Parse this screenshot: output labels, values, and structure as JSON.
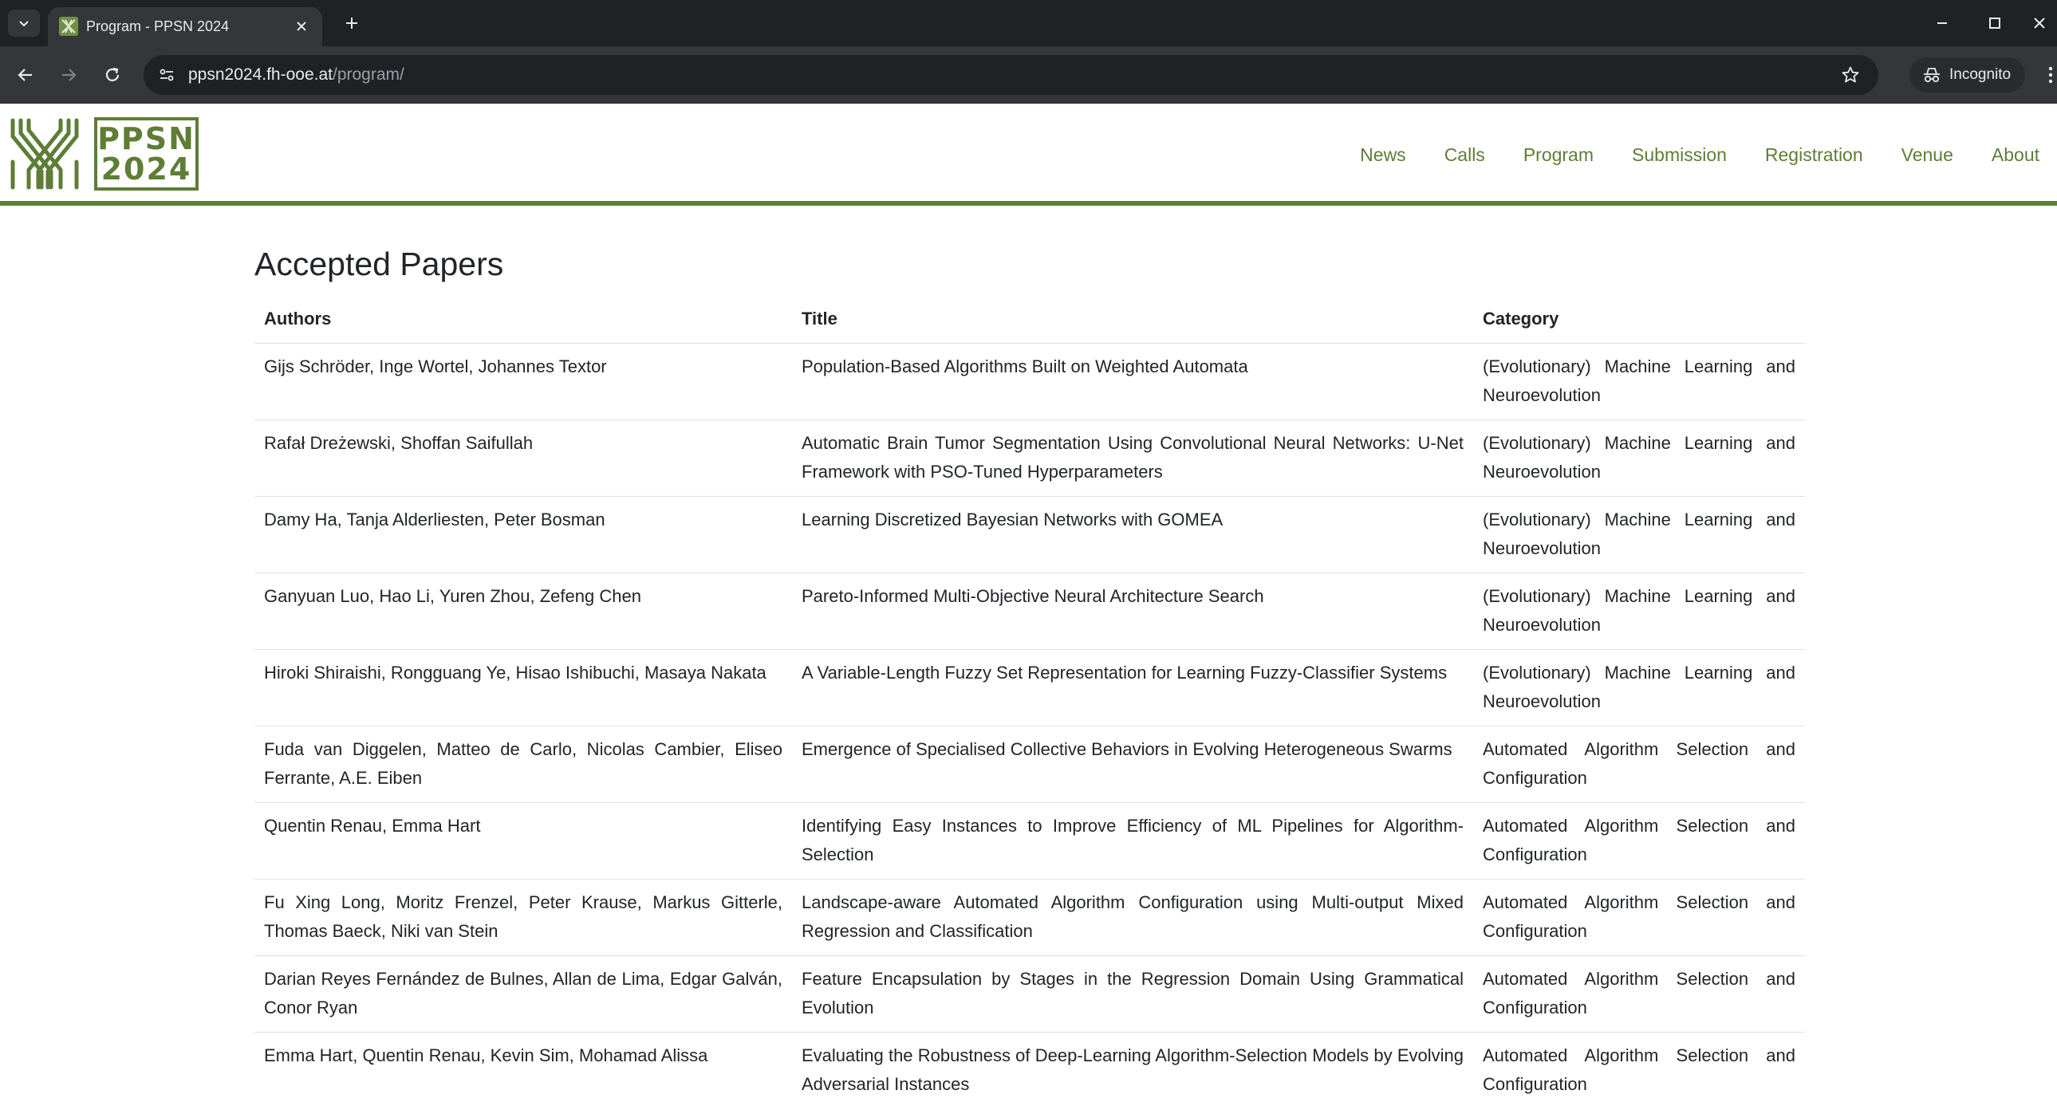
{
  "browser": {
    "tab_title": "Program - PPSN 2024",
    "url_host": "ppsn2024.fh-ooe.at",
    "url_path": "/program/",
    "incognito_label": "Incognito"
  },
  "site": {
    "logo_line1": "PPSN",
    "logo_line2": "2024",
    "nav": [
      "News",
      "Calls",
      "Program",
      "Submission",
      "Registration",
      "Venue",
      "About"
    ],
    "brand_color": "#5e7d35"
  },
  "page": {
    "title": "Accepted Papers",
    "columns": [
      "Authors",
      "Title",
      "Category"
    ],
    "rows": [
      {
        "authors": "Gijs Schröder, Inge Wortel, Johannes Textor",
        "title": "Population-Based Algorithms Built on Weighted Automata",
        "category": "(Evolutionary) Machine Learning and Neuroevolution"
      },
      {
        "authors": "Rafał Dreżewski, Shoffan Saifullah",
        "title": "Automatic Brain Tumor Segmentation Using Convolutional Neural Networks: U-Net Framework with PSO-Tuned Hyperparameters",
        "category": "(Evolutionary) Machine Learning and Neuroevolution"
      },
      {
        "authors": "Damy Ha, Tanja Alderliesten, Peter Bosman",
        "title": "Learning Discretized Bayesian Networks with GOMEA",
        "category": "(Evolutionary) Machine Learning and Neuroevolution"
      },
      {
        "authors": "Ganyuan Luo, Hao Li, Yuren Zhou, Zefeng Chen",
        "title": "Pareto-Informed Multi-Objective Neural Architecture Search",
        "category": "(Evolutionary) Machine Learning and Neuroevolution"
      },
      {
        "authors": "Hiroki Shiraishi, Rongguang Ye, Hisao Ishibuchi, Masaya Nakata",
        "title": "A Variable-Length Fuzzy Set Representation for Learning Fuzzy-Classifier Systems",
        "category": "(Evolutionary) Machine Learning and Neuroevolution"
      },
      {
        "authors": "Fuda van Diggelen, Matteo de Carlo, Nicolas Cambier, Eliseo Ferrante, A.E. Eiben",
        "title": "Emergence of Specialised Collective Behaviors in Evolving Heterogeneous Swarms",
        "category": "Automated Algorithm Selection and Configuration"
      },
      {
        "authors": "Quentin Renau, Emma Hart",
        "title": "Identifying Easy Instances to Improve Efficiency of ML Pipelines for Algorithm-Selection",
        "category": "Automated Algorithm Selection and Configuration"
      },
      {
        "authors": "Fu Xing Long, Moritz Frenzel, Peter Krause, Markus Gitterle, Thomas Baeck, Niki van Stein",
        "title": "Landscape-aware Automated Algorithm Configuration using Multi-output Mixed Regression and Classification",
        "category": "Automated Algorithm Selection and Configuration"
      },
      {
        "authors": "Darian Reyes Fernández de Bulnes, Allan de Lima, Edgar Galván, Conor Ryan",
        "title": "Feature Encapsulation by Stages in the Regression Domain Using Grammatical Evolution",
        "category": "Automated Algorithm Selection and Configuration"
      },
      {
        "authors": "Emma Hart, Quentin Renau, Kevin Sim, Mohamad Alissa",
        "title": "Evaluating the Robustness of Deep-Learning Algorithm-Selection Models by Evolving Adversarial Instances",
        "category": "Automated Algorithm Selection and Configuration"
      }
    ]
  }
}
